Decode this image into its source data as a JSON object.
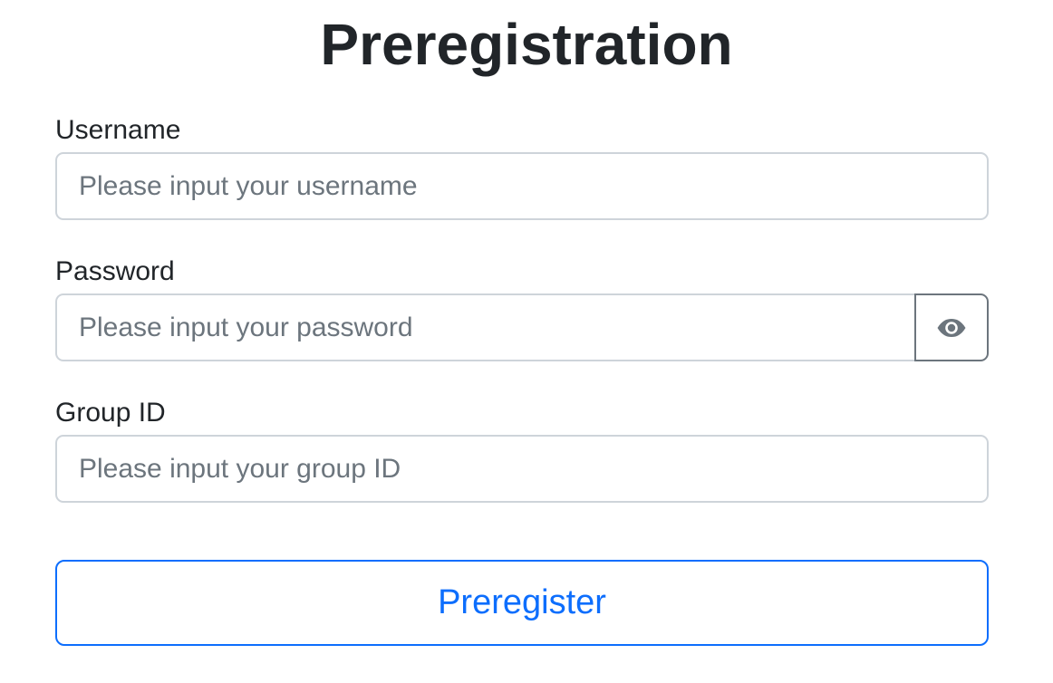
{
  "page": {
    "title": "Preregistration"
  },
  "form": {
    "username": {
      "label": "Username",
      "placeholder": "Please input your username"
    },
    "password": {
      "label": "Password",
      "placeholder": "Please input your password",
      "toggle_icon": "eye-icon"
    },
    "group_id": {
      "label": "Group ID",
      "placeholder": "Please input your group ID"
    },
    "submit_label": "Preregister"
  },
  "colors": {
    "primary": "#0d6efd",
    "text": "#212529",
    "placeholder": "#6c757d",
    "input_border": "#ced4da"
  }
}
